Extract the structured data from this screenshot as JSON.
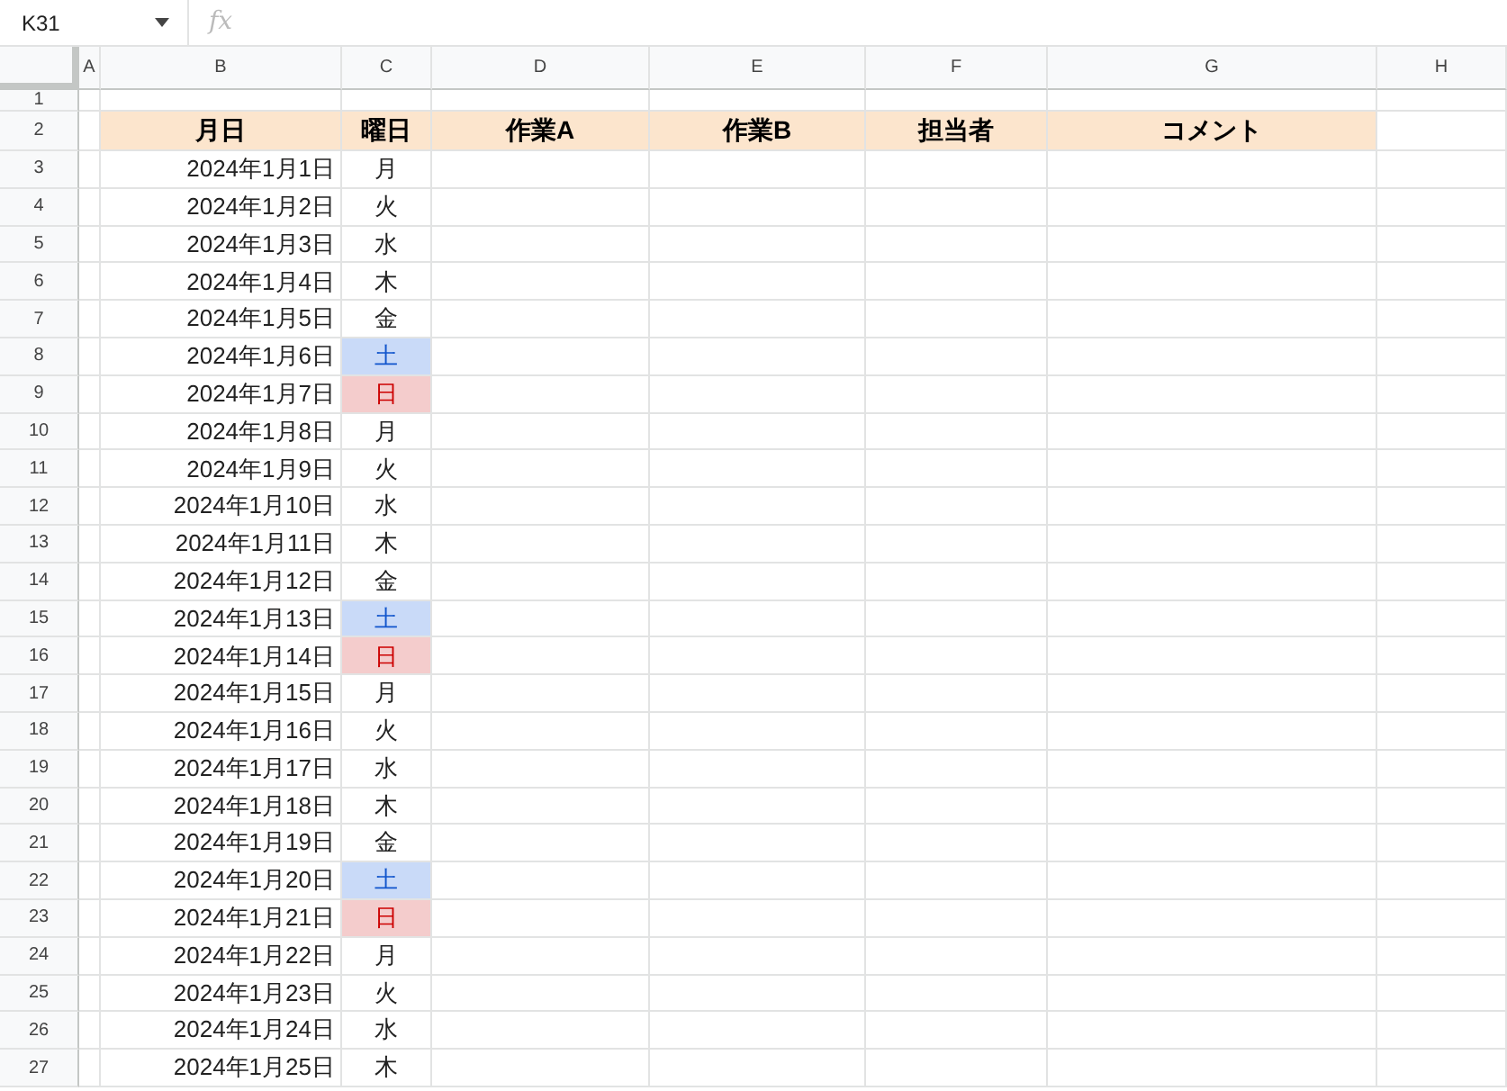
{
  "formula_bar": {
    "name_box": "K31",
    "formula_icon": "fx"
  },
  "column_headers": [
    "A",
    "B",
    "C",
    "D",
    "E",
    "F",
    "G",
    "H"
  ],
  "blank_row": {
    "number": "1"
  },
  "header_row": {
    "number": "2",
    "cells": [
      "月日",
      "曜日",
      "作業A",
      "作業B",
      "担当者",
      "コメント"
    ]
  },
  "rows": [
    {
      "number": "3",
      "date": "2024年1月1日",
      "weekday": "月",
      "kind": "weekday"
    },
    {
      "number": "4",
      "date": "2024年1月2日",
      "weekday": "火",
      "kind": "weekday"
    },
    {
      "number": "5",
      "date": "2024年1月3日",
      "weekday": "水",
      "kind": "weekday"
    },
    {
      "number": "6",
      "date": "2024年1月4日",
      "weekday": "木",
      "kind": "weekday"
    },
    {
      "number": "7",
      "date": "2024年1月5日",
      "weekday": "金",
      "kind": "weekday"
    },
    {
      "number": "8",
      "date": "2024年1月6日",
      "weekday": "土",
      "kind": "saturday"
    },
    {
      "number": "9",
      "date": "2024年1月7日",
      "weekday": "日",
      "kind": "sunday"
    },
    {
      "number": "10",
      "date": "2024年1月8日",
      "weekday": "月",
      "kind": "weekday"
    },
    {
      "number": "11",
      "date": "2024年1月9日",
      "weekday": "火",
      "kind": "weekday"
    },
    {
      "number": "12",
      "date": "2024年1月10日",
      "weekday": "水",
      "kind": "weekday"
    },
    {
      "number": "13",
      "date": "2024年1月11日",
      "weekday": "木",
      "kind": "weekday"
    },
    {
      "number": "14",
      "date": "2024年1月12日",
      "weekday": "金",
      "kind": "weekday"
    },
    {
      "number": "15",
      "date": "2024年1月13日",
      "weekday": "土",
      "kind": "saturday"
    },
    {
      "number": "16",
      "date": "2024年1月14日",
      "weekday": "日",
      "kind": "sunday"
    },
    {
      "number": "17",
      "date": "2024年1月15日",
      "weekday": "月",
      "kind": "weekday"
    },
    {
      "number": "18",
      "date": "2024年1月16日",
      "weekday": "火",
      "kind": "weekday"
    },
    {
      "number": "19",
      "date": "2024年1月17日",
      "weekday": "水",
      "kind": "weekday"
    },
    {
      "number": "20",
      "date": "2024年1月18日",
      "weekday": "木",
      "kind": "weekday"
    },
    {
      "number": "21",
      "date": "2024年1月19日",
      "weekday": "金",
      "kind": "weekday"
    },
    {
      "number": "22",
      "date": "2024年1月20日",
      "weekday": "土",
      "kind": "saturday"
    },
    {
      "number": "23",
      "date": "2024年1月21日",
      "weekday": "日",
      "kind": "sunday"
    },
    {
      "number": "24",
      "date": "2024年1月22日",
      "weekday": "月",
      "kind": "weekday"
    },
    {
      "number": "25",
      "date": "2024年1月23日",
      "weekday": "火",
      "kind": "weekday"
    },
    {
      "number": "26",
      "date": "2024年1月24日",
      "weekday": "水",
      "kind": "weekday"
    },
    {
      "number": "27",
      "date": "2024年1月25日",
      "weekday": "木",
      "kind": "weekday"
    }
  ]
}
